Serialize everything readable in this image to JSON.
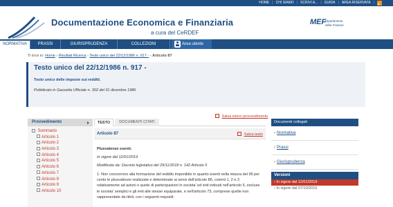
{
  "topbar": {
    "links": [
      "HOME",
      "CHI SIAMO",
      "SCRIVI A...",
      "GUIDA",
      "AREA RISERVATA"
    ]
  },
  "header": {
    "title": "Documentazione Economica e Finanziaria",
    "subtitle": "a cura del CeRDEF",
    "mef_logo": "MEF",
    "mef_line1": "Dipartimento",
    "mef_line2": "delle Finanze"
  },
  "nav": {
    "items": [
      "NORMATIVA",
      "PRASSI",
      "GIURISPRUDENZA",
      "COLLEZIONI"
    ],
    "user": "Area utente"
  },
  "breadcrumb": {
    "prefix": "Ti trovi in:",
    "home": "Home",
    "ricerca": "Risultati Ricerca",
    "testo": "Testo unico del 22/12/1986 n. 917 -",
    "current": "Articolo 87"
  },
  "document": {
    "title": "Testo unico del 22/12/1986 n. 917 -",
    "subtitle": "Testo unico delle imposte sui redditi.",
    "published": "Pubblicato in Gazzetta Ufficiale n. 302 del 31 dicembre 1986"
  },
  "save_all": "Salva intero provvedimento",
  "left": {
    "header": "Provvedimento",
    "root": "Sommario",
    "items": [
      "Articolo 1",
      "Articolo 2",
      "Articolo 3",
      "Articolo 4",
      "Articolo 5",
      "Articolo 6",
      "Articolo 7",
      "Articolo 8",
      "Articolo 9",
      "Articolo 10"
    ]
  },
  "tabs": [
    "TESTO",
    "DOCUMENTI CITATI"
  ],
  "article": {
    "title": "Articolo 87",
    "save": "Salva testo",
    "heading": "Plusvalenze esenti.",
    "in_force": "In vigore dal 12/01/2019",
    "modified": "Modificato da: Decreto legislativo del 29/11/2018 n. 142 Articolo 5",
    "comma": "1. Non concorrono alla formazione del reddito imponibile in quanto esenti nella misura del 95 per cento le plusvalenze realizzate e determinate ai sensi dell'articolo 86, commi 1, 2 e 3 relativamente ad azioni o quote di partecipazioni in societa' ed enti indicati nell'articolo 5, escluse le societa' semplici e gli enti alle stesse equiparate, e nell'articolo 73, comprese quelle non rappresentate da titoli, con i seguenti requisiti:"
  },
  "right": {
    "header": "Documenti collegati",
    "links": [
      "Normativa",
      "Prassi",
      "Giurisprudenza"
    ],
    "versions_header": "Versioni",
    "versions": [
      "In vigore dal 12/01/2019",
      "In vigore dal 07/10/2015"
    ]
  }
}
